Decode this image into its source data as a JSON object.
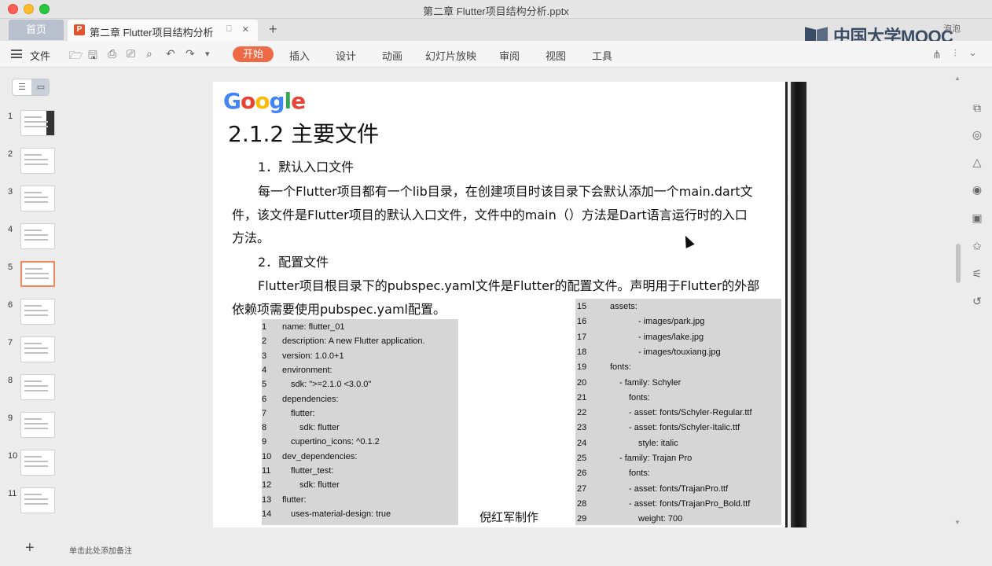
{
  "window": {
    "title": "第二章 Flutter项目结构分析.pptx"
  },
  "tabs": {
    "home": "首页",
    "doc": "第二章 Flutter项目结构分析",
    "doc_icon": "P",
    "add": "+",
    "pin": "⎕",
    "close": "×"
  },
  "brand": {
    "mooc": "中国大学MOOC",
    "user": "泡泡"
  },
  "menu": {
    "file": "文件",
    "ribbon": [
      "开始",
      "插入",
      "设计",
      "动画",
      "幻灯片放映",
      "审阅",
      "视图",
      "工具"
    ]
  },
  "sidepanel": {
    "slides": [
      "1",
      "2",
      "3",
      "4",
      "5",
      "6",
      "7",
      "8",
      "9",
      "10",
      "11"
    ],
    "active_slide": "5",
    "notes_hint": "单击此处添加备注",
    "add": "+"
  },
  "slide": {
    "logo_letters": [
      "G",
      "o",
      "o",
      "g",
      "l",
      "e"
    ],
    "logo_colors": [
      "#4285f4",
      "#ea4335",
      "#fbbc05",
      "#4285f4",
      "#34a853",
      "#ea4335"
    ],
    "title": "2.1.2 主要文件",
    "h1": "1．默认入口文件",
    "p1_l1": "每一个Flutter项目都有一个lib目录，在创建项目时该目录下会默认添加一个main.dart文",
    "p1_l2": "件，该文件是Flutter项目的默认入口文件，文件中的main（）方法是Dart语言运行时的入口",
    "p1_l3": "方法。",
    "h2": "2．配置文件",
    "p2_l1": "Flutter项目根目录下的pubspec.yaml文件是Flutter的配置文件。声明用于Flutter的外部",
    "p2_l2": "依赖项需要使用pubspec.yaml配置。",
    "author": "倪红军制作",
    "code_left": [
      {
        "n": "1",
        "t": "name: flutter_01",
        "i": 0
      },
      {
        "n": "2",
        "t": "description: A new Flutter application.",
        "i": 0
      },
      {
        "n": "3",
        "t": "version: 1.0.0+1",
        "i": 0
      },
      {
        "n": "4",
        "t": "environment:",
        "i": 0
      },
      {
        "n": "5",
        "t": "sdk: \">=2.1.0 <3.0.0\"",
        "i": 1
      },
      {
        "n": "6",
        "t": "dependencies:",
        "i": 0
      },
      {
        "n": "7",
        "t": "flutter:",
        "i": 1
      },
      {
        "n": "8",
        "t": "sdk: flutter",
        "i": 2
      },
      {
        "n": "9",
        "t": "cupertino_icons: ^0.1.2",
        "i": 1
      },
      {
        "n": "10",
        "t": "dev_dependencies:",
        "i": 0
      },
      {
        "n": "11",
        "t": "flutter_test:",
        "i": 1
      },
      {
        "n": "12",
        "t": "sdk: flutter",
        "i": 2
      },
      {
        "n": "13",
        "t": "flutter:",
        "i": 0
      },
      {
        "n": "14",
        "t": "uses-material-design: true",
        "i": 1
      }
    ],
    "code_right": [
      {
        "n": "15",
        "t": "assets:",
        "i": 1
      },
      {
        "n": "16",
        "t": "- images/park.jpg",
        "i": 4
      },
      {
        "n": "17",
        "t": "- images/lake.jpg",
        "i": 4
      },
      {
        "n": "18",
        "t": "- images/touxiang.jpg",
        "i": 4
      },
      {
        "n": "19",
        "t": "fonts:",
        "i": 1
      },
      {
        "n": "20",
        "t": "- family: Schyler",
        "i": 2
      },
      {
        "n": "21",
        "t": "fonts:",
        "i": 3
      },
      {
        "n": "22",
        "t": "- asset: fonts/Schyler-Regular.ttf",
        "i": 3
      },
      {
        "n": "23",
        "t": "- asset: fonts/Schyler-Italic.ttf",
        "i": 3
      },
      {
        "n": "24",
        "t": "style: italic",
        "i": 4
      },
      {
        "n": "25",
        "t": "- family: Trajan Pro",
        "i": 2
      },
      {
        "n": "26",
        "t": "fonts:",
        "i": 3
      },
      {
        "n": "27",
        "t": "- asset: fonts/TrajanPro.ttf",
        "i": 3
      },
      {
        "n": "28",
        "t": "- asset: fonts/TrajanPro_Bold.ttf",
        "i": 3
      },
      {
        "n": "29",
        "t": "weight: 700",
        "i": 4
      }
    ]
  },
  "icons": {
    "quick_access": [
      "folder-open-icon",
      "save-icon",
      "print-preview-icon",
      "print-icon",
      "export-icon",
      "undo-icon",
      "redo-icon",
      "customize-icon"
    ],
    "right_tools": [
      "slide-layout-icon",
      "shapes-icon",
      "style-icon",
      "animation-icon",
      "transition-icon",
      "effects-icon",
      "settings-icon",
      "history-icon"
    ]
  }
}
